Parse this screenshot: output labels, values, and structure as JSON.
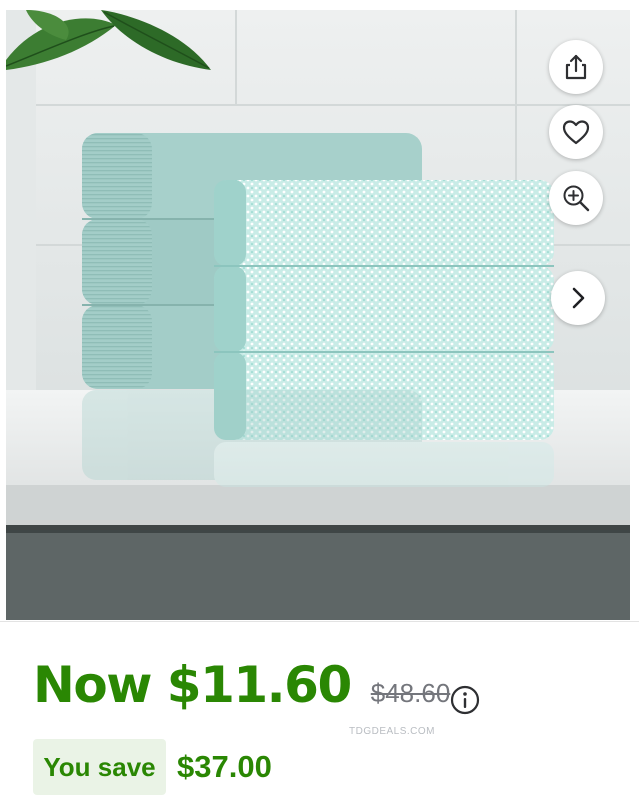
{
  "product": {
    "image_alt": "Stack of light aqua towels on a bathroom shelf"
  },
  "image_actions": {
    "share_icon": "share-icon",
    "favorite_icon": "heart-icon",
    "zoom_icon": "zoom-in-icon",
    "next_icon": "chevron-right-icon"
  },
  "pricing": {
    "now_price": "Now $11.60",
    "was_price": "$48.60",
    "savings_label": "You save",
    "savings_amount": "$37.00",
    "watermark": "TDGDEALS.COM"
  },
  "colors": {
    "price_green": "#2a8703",
    "savings_badge_bg": "#eaf3e6",
    "strike_gray": "#74767c",
    "towel_aqua": "#a9d3ce"
  }
}
